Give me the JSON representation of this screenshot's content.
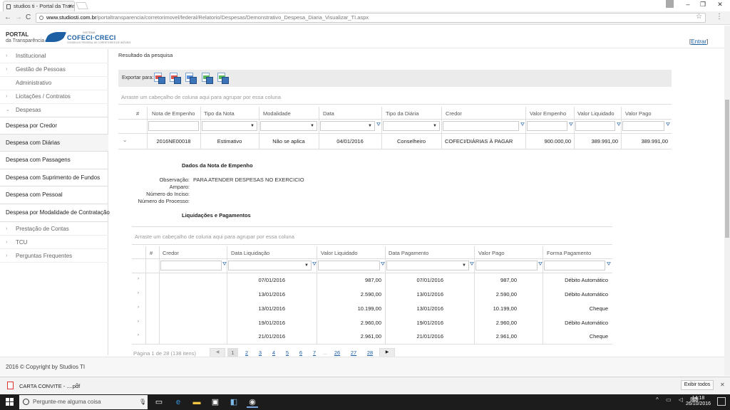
{
  "browser": {
    "tab_title": "studios ti - Portal da Trans",
    "tab_close": "×",
    "nav_back": "←",
    "nav_forward": "→",
    "nav_reload": "C",
    "url_host": "www.studiosti.com.br",
    "url_path": "/portaltransparencia/corretorimovel/federal/Relatorio/Despesas/Demonstrativo_Despesa_Diaria_Visualizar_TI.aspx",
    "star": "☆",
    "menu": "⋮",
    "win_min": "–",
    "win_max": "❐",
    "win_close": "✕"
  },
  "header": {
    "logo_portal": "PORTAL",
    "logo_portal_sub": "da Transparência",
    "logo_sistema": "SISTEMA",
    "logo_cofeci": "COFECI·CRECI",
    "logo_tagline": "CONSELHO FEDERAL DE CORRETORES DE IMÓVEIS",
    "login_open": "[",
    "login_label": "Entrar",
    "login_close": "]"
  },
  "sidebar": {
    "sections": [
      {
        "label": "Institucional",
        "chevron": "›"
      },
      {
        "label": "Gestão de Pessoas",
        "chevron": "›"
      },
      {
        "label": "Administrativo",
        "chevron": ""
      },
      {
        "label": "Licitações / Contratos",
        "chevron": "›"
      },
      {
        "label": "Despesas",
        "chevron": "⌄"
      }
    ],
    "despesas_items": [
      "Despesa por Credor",
      "Despesa com Diárias",
      "Despesa com Passagens",
      "Despesa com Suprimento de Fundos",
      "Despesa com Pessoal",
      "Despesa por Modalidade de Contratação"
    ],
    "bottom_sections": [
      {
        "label": "Prestação de Contas",
        "chevron": "›"
      },
      {
        "label": "TCU",
        "chevron": "›"
      },
      {
        "label": "Perguntas Frequentes",
        "chevron": "›"
      }
    ]
  },
  "main": {
    "result_title": "Resultado da pesquisa",
    "export_label": "Exportar para:",
    "export_formats": [
      {
        "icon": "export-pdf-icon",
        "color": "#d9534f"
      },
      {
        "icon": "export-xls-icon",
        "color": "#d9534f"
      },
      {
        "icon": "export-xlsx-icon",
        "color": "#5b8fd6"
      },
      {
        "icon": "export-rtf-icon",
        "color": "#5cb85c"
      },
      {
        "icon": "export-csv-icon",
        "color": "#5cb85c"
      }
    ],
    "group_hint": "Arraste um cabeçalho de coluna aqui para agrupar por essa coluna",
    "grid": {
      "columns": [
        "#",
        "Nota de Empenho",
        "Tipo da Nota",
        "Modalidade",
        "Data",
        "Tipo da Diária",
        "Credor",
        "Valor Empenho",
        "Valor Liquidado",
        "Valor Pago"
      ],
      "row": {
        "expander": "⌄",
        "nota": "2016NE00018",
        "tipo": "Estimativo",
        "modalidade": "Não se aplica",
        "data": "04/01/2016",
        "tipo_diaria": "Conselheiro",
        "credor": "COFECI/DIÁRIAS À PAGAR",
        "valor_empenho": "900.000,00",
        "valor_liquidado": "389.991,00",
        "valor_pago": "389.991,00"
      }
    },
    "detail": {
      "title": "Dados da Nota de Empenho",
      "observacao_label": "Observação:",
      "observacao_value": "PARA ATENDER DESPESAS NO EXERCICIO",
      "amparo_label": "Amparo:",
      "inciso_label": "Número do Inciso:",
      "processo_label": "Número do Processo:"
    },
    "liquidacoes": {
      "title": "Liquidações e Pagamentos",
      "group_hint": "Arraste um cabeçalho de coluna aqui para agrupar por essa coluna",
      "columns": [
        "#",
        "Credor",
        "Data Liquidação",
        "Valor Liquidado",
        "Data Pagamento",
        "Valor Pago",
        "Forma Pagamento"
      ],
      "rows": [
        {
          "expander": "›",
          "data_liq": "07/01/2016",
          "valor_liq": "987,00",
          "data_pag": "07/01/2016",
          "valor_pago": "987,00",
          "forma": "Débito Automático"
        },
        {
          "expander": "›",
          "data_liq": "13/01/2016",
          "valor_liq": "2.590,00",
          "data_pag": "13/01/2016",
          "valor_pago": "2.590,00",
          "forma": "Débito Automático"
        },
        {
          "expander": "›",
          "data_liq": "13/01/2016",
          "valor_liq": "10.199,00",
          "data_pag": "13/01/2016",
          "valor_pago": "10.199,00",
          "forma": "Cheque"
        },
        {
          "expander": "›",
          "data_liq": "19/01/2016",
          "valor_liq": "2.960,00",
          "data_pag": "19/01/2016",
          "valor_pago": "2.960,00",
          "forma": "Débito Automático"
        },
        {
          "expander": "›",
          "data_liq": "21/01/2016",
          "valor_liq": "2.961,00",
          "data_pag": "21/01/2016",
          "valor_pago": "2.961,00",
          "forma": "Cheque"
        }
      ],
      "pager": {
        "info": "Página 1 de 28 (138 itens)",
        "prev": "◀",
        "current": "1",
        "pages": [
          "2",
          "3",
          "4",
          "5",
          "6",
          "7"
        ],
        "ellipsis": "...",
        "tail": [
          "26",
          "27",
          "28"
        ],
        "next": "▶"
      }
    }
  },
  "footer": {
    "copyright": "2016 © Copyright by Studios TI"
  },
  "downloads": {
    "file_name": "CARTA CONVITE - ....pdf",
    "chevron": "^",
    "show_all": "Exibir todos",
    "close": "✕"
  },
  "taskbar": {
    "search_placeholder": "Pergunte-me alguma coisa",
    "mic": "🎙",
    "tray": "^ ▭ ◁ ⌨",
    "time": "14:18",
    "date": "26/10/2016"
  }
}
